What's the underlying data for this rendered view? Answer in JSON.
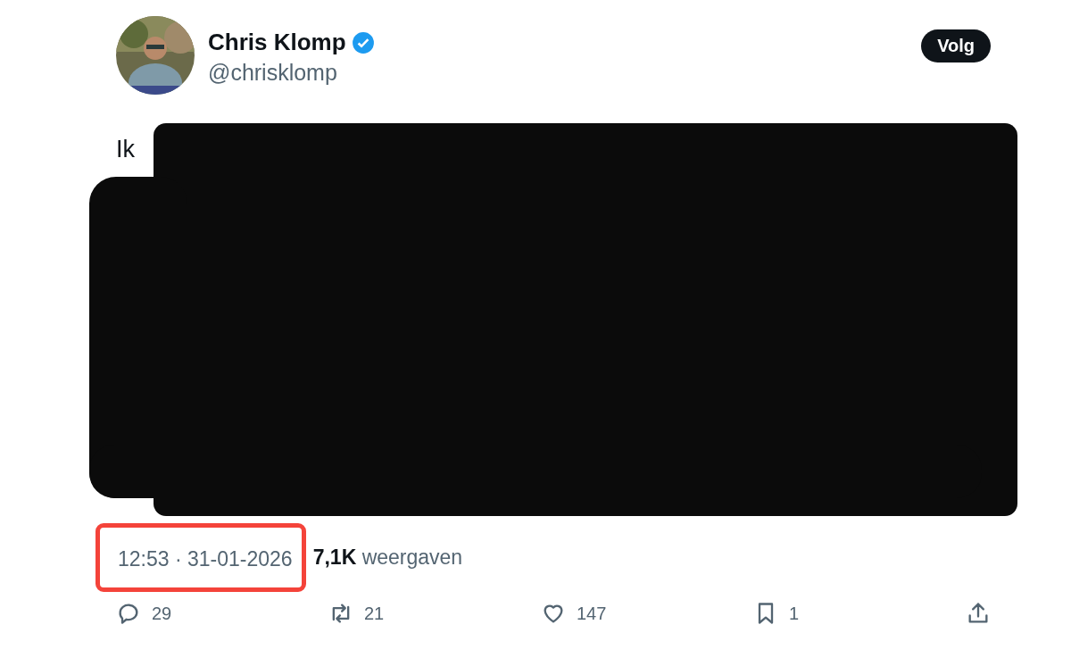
{
  "author": {
    "name": "Chris Klomp",
    "verified": true,
    "handle": "@chrisklomp",
    "follow_label": "Volg"
  },
  "tweet": {
    "visible_text": "Ik",
    "redacted": true
  },
  "meta": {
    "time": "12:53 · 31-01-2026",
    "time_highlighted": true,
    "views_count": "7,1K",
    "views_label": "weergaven"
  },
  "actions": [
    {
      "kind": "reply",
      "count": "29"
    },
    {
      "kind": "retweet",
      "count": "21"
    },
    {
      "kind": "like",
      "count": "147"
    },
    {
      "kind": "bookmark",
      "count": "1"
    },
    {
      "kind": "share"
    }
  ]
}
